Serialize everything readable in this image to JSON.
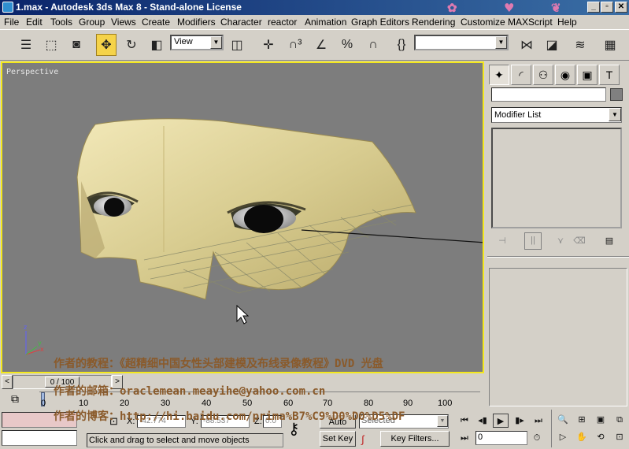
{
  "window": {
    "title": "1.max - Autodesk 3ds Max 8 - Stand-alone License",
    "minimize": "_",
    "maximize": "▫",
    "close": "✕"
  },
  "menu": [
    "File",
    "Edit",
    "Tools",
    "Group",
    "Views",
    "Create",
    "Modifiers",
    "Character",
    "reactor",
    "Animation",
    "Graph Editors",
    "Rendering",
    "Customize",
    "MAXScript",
    "Help"
  ],
  "toolbar": {
    "ref_coord": "View",
    "named_selection": ""
  },
  "viewport": {
    "label": "Perspective"
  },
  "overlay": {
    "line1": "作者的教程：《超精细中国女性头部建模及布线录像教程》DVD 光盘",
    "line2": "作者的邮箱：oraclemean.meayihe@yahoo.com.cn",
    "line3": "作者的博客：http://hi.baidu.com/prima%B7%C9%D0%D0%D5%DF"
  },
  "timeline": {
    "slider": "0 / 100",
    "prev": "<",
    "next": ">",
    "ticks": [
      "0",
      "10",
      "20",
      "30",
      "40",
      "50",
      "60",
      "70",
      "80",
      "90",
      "100"
    ]
  },
  "status": {
    "x_label": "X:",
    "x_value": "-42.774",
    "y_label": "Y:",
    "y_value": "-88.537",
    "z_label": "Z:",
    "z_value": "0.0",
    "prompt": "Click and drag to select and move objects",
    "autokey": "Auto Key",
    "setkey": "Set Key",
    "selected": "Selected",
    "keyfilters": "Key Filters...",
    "frame": "0"
  },
  "cmdpanel": {
    "modifier_list": "Modifier List"
  }
}
